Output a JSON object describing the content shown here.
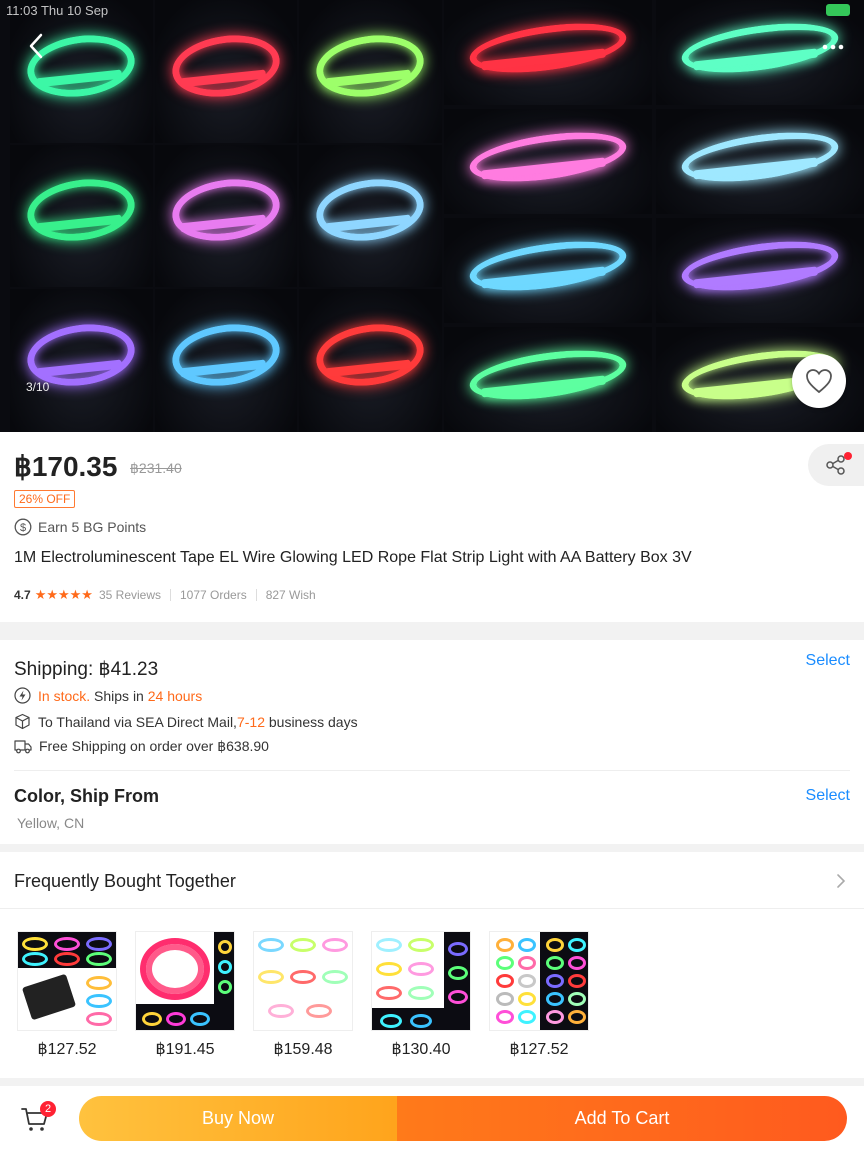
{
  "status_bar": {
    "time": "11:03  Thu 10 Sep"
  },
  "gallery": {
    "counter": "3/10",
    "left_colors": [
      "#3cf7a6",
      "#ff3b52",
      "#9dff6a",
      "#38f08c",
      "#e87cf0",
      "#8fd6ff",
      "#a370ff",
      "#5fc8ff",
      "#ff3b3b"
    ],
    "right_colors": [
      "#ff3344",
      "#5effc5",
      "#ff7ce0",
      "#9fe8ff",
      "#6fd8ff",
      "#b07bff",
      "#5dffa0",
      "#c8ff8a"
    ],
    "icons": {
      "back": "chevron-left-icon",
      "more": "more-dots-icon",
      "wish": "heart-icon"
    }
  },
  "product": {
    "price": "฿170.35",
    "old_price": "฿231.40",
    "discount": "26% OFF",
    "points": "Earn 5 BG Points",
    "title": "1M Electroluminescent Tape EL Wire Glowing LED Rope Flat Strip Light with AA Battery Box 3V",
    "rating": "4.7",
    "rating_value": 4.7,
    "reviews": "35 Reviews",
    "orders": "1077 Orders",
    "wish": "827 Wish"
  },
  "shipping": {
    "title": "Shipping: ฿41.23",
    "select_label": "Select",
    "stock_status": "In stock.",
    "ships_in_prefix": "Ships in",
    "ships_in_time": "24 hours",
    "route_prefix": "To Thailand via SEA Direct Mail,",
    "route_days": "7-12",
    "route_suffix": "business days",
    "free_shipping": "Free Shipping on order over ฿638.90"
  },
  "variant": {
    "title": "Color, Ship From",
    "select_label": "Select",
    "value": "Yellow, CN"
  },
  "frequently_bought": {
    "title": "Frequently Bought Together",
    "items": [
      {
        "price": "฿127.52"
      },
      {
        "price": "฿191.45"
      },
      {
        "price": "฿159.48"
      },
      {
        "price": "฿130.40"
      },
      {
        "price": "฿127.52"
      }
    ]
  },
  "bottom_bar": {
    "cart_count": "2",
    "buy_now": "Buy Now",
    "add_to_cart": "Add To Cart"
  },
  "colors": {
    "accent_orange": "#ff6a1a",
    "link_blue": "#1a8cff",
    "buy_now_gradient": [
      "#ffc23e",
      "#ffa41c"
    ],
    "add_cart_gradient": [
      "#ff7a1a",
      "#ff5a1e"
    ]
  }
}
